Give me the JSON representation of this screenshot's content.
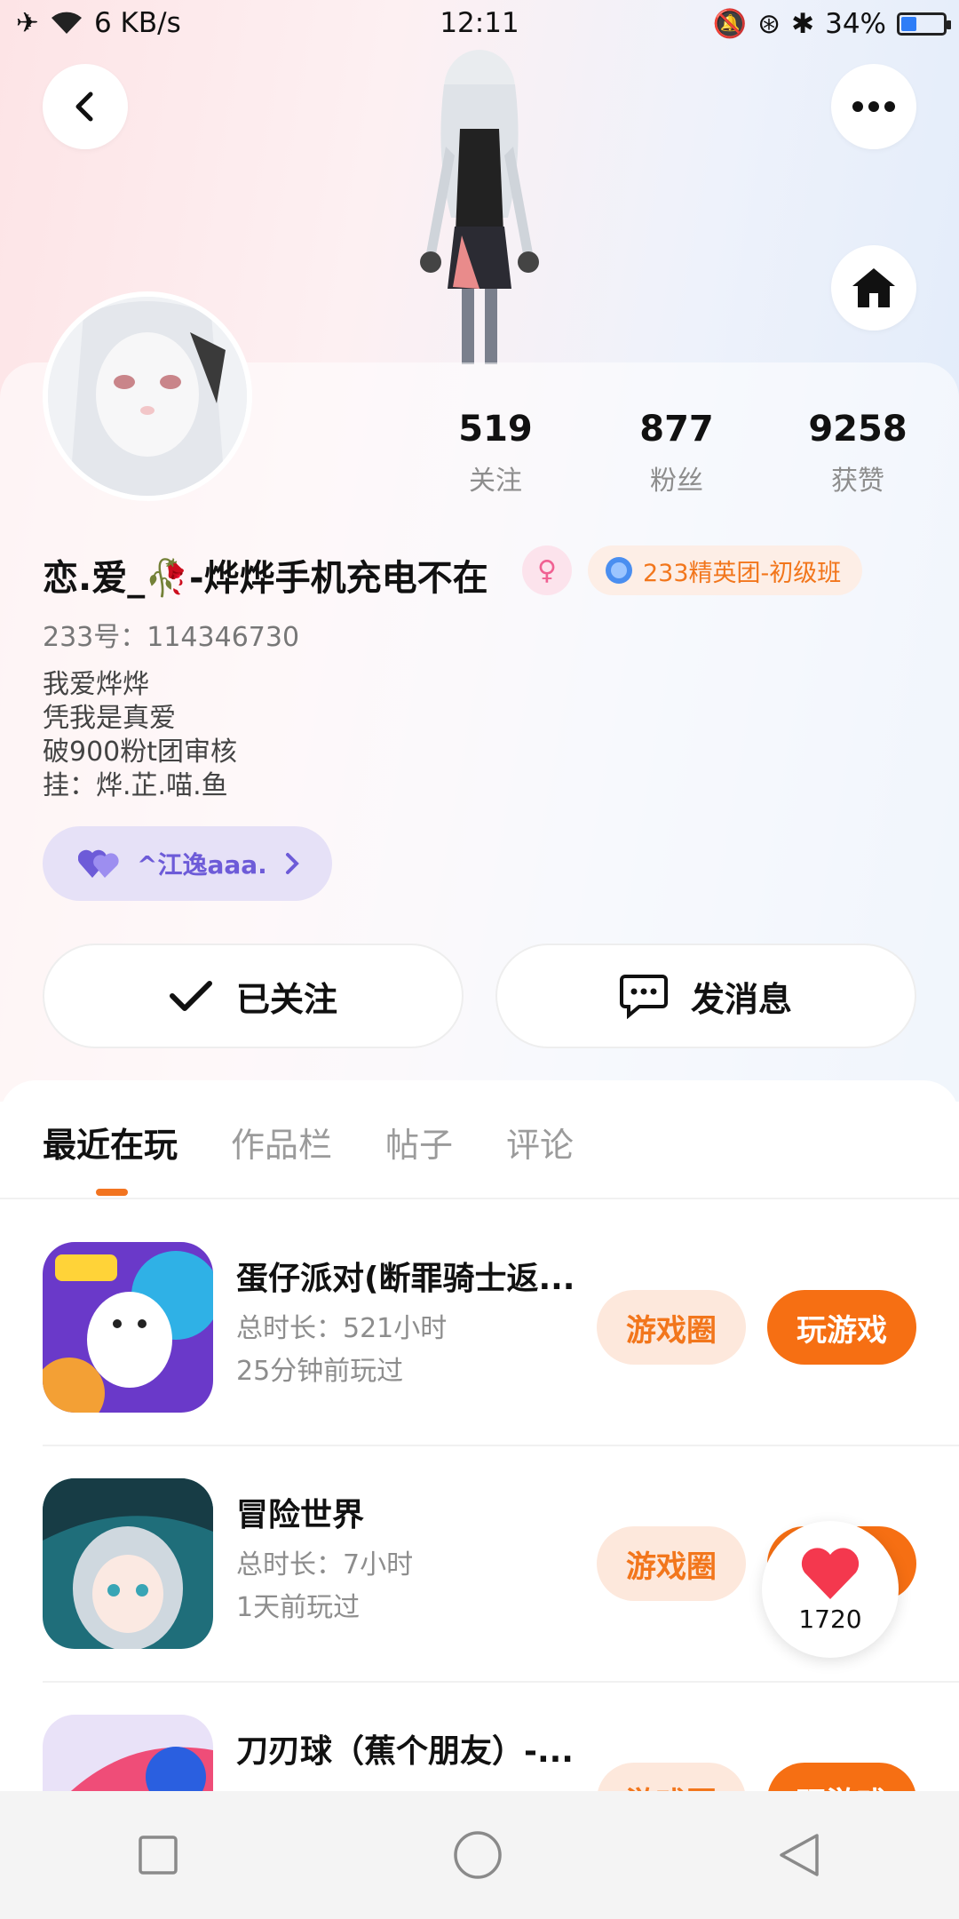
{
  "status_bar": {
    "speed": "6 KB/s",
    "time": "12:11",
    "battery": "34%"
  },
  "stats": [
    {
      "num": "519",
      "label": "关注"
    },
    {
      "num": "877",
      "label": "粉丝"
    },
    {
      "num": "9258",
      "label": "获赞"
    }
  ],
  "profile": {
    "name": "恋.爱_🥀-烨烨手机充电不在",
    "badge": "233精英团-初级班",
    "uid": "233号：114346730",
    "bio": [
      "我爱烨烨",
      "凭我是真爱",
      "破900粉t团审核",
      "挂：烨.芷.喵.鱼"
    ],
    "cp_name": "^江逸aaa."
  },
  "actions": {
    "followed": "已关注",
    "message": "发消息"
  },
  "tabs": [
    "最近在玩",
    "作品栏",
    "帖子",
    "评论"
  ],
  "games": [
    {
      "title": "蛋仔派对(断罪骑士返...",
      "duration": "总时长：521小时",
      "last_played": "25分钟前玩过",
      "circle": "游戏圈",
      "play": "玩游戏"
    },
    {
      "title": "冒险世界",
      "duration": "总时长：7小时",
      "last_played": "1天前玩过",
      "circle": "游戏圈",
      "play": "玩游戏"
    },
    {
      "title": "刀刃球（蕉个朋友）-...",
      "duration": "",
      "last_played": "",
      "circle": "游戏圈",
      "play": "玩游戏"
    }
  ],
  "likes": "1720",
  "colors": {
    "accent": "#f66f13",
    "accent_soft": "#fde8dc",
    "cp_purple": "#6d5bd8"
  }
}
